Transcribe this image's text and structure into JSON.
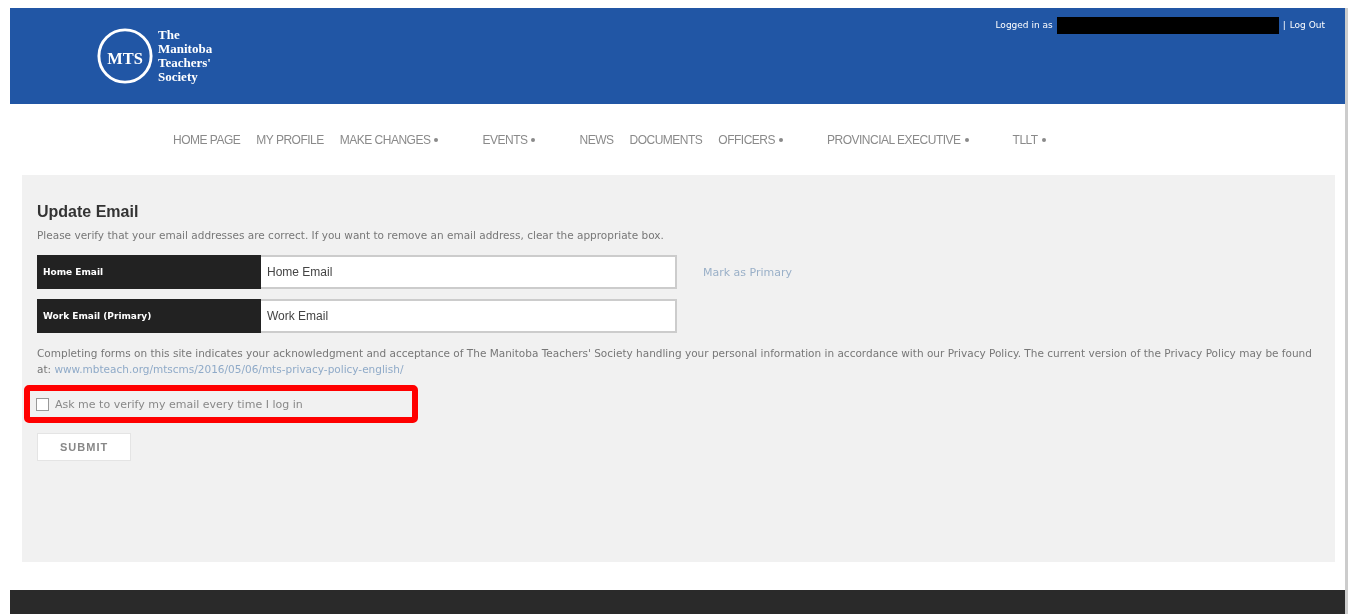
{
  "header": {
    "logo_mark": "MTS",
    "logo_text": [
      "The",
      "Manitoba",
      "Teachers'",
      "Society"
    ],
    "logged_in_label": "Logged in as",
    "separator": "|",
    "logout": "Log Out"
  },
  "nav": [
    {
      "label": "HOME PAGE",
      "has_dropdown": false
    },
    {
      "label": "MY PROFILE",
      "has_dropdown": false
    },
    {
      "label": "MAKE CHANGES",
      "has_dropdown": true
    },
    {
      "label": "EVENTS",
      "has_dropdown": true
    },
    {
      "label": "NEWS",
      "has_dropdown": false
    },
    {
      "label": "DOCUMENTS",
      "has_dropdown": false
    },
    {
      "label": "OFFICERS",
      "has_dropdown": true
    },
    {
      "label": "PROVINCIAL EXECUTIVE",
      "has_dropdown": true
    },
    {
      "label": "TLLT",
      "has_dropdown": true
    }
  ],
  "form": {
    "title": "Update Email",
    "intro": "Please verify that your email addresses are correct. If you want to remove an email address, clear the appropriate box.",
    "emails": [
      {
        "label": "Home Email",
        "value": "Home Email",
        "action": "Mark as Primary"
      },
      {
        "label": "Work Email (Primary)",
        "value": "Work Email"
      }
    ],
    "notice": "Completing forms on this site indicates your acknowledgment and acceptance of The Manitoba Teachers' Society handling your personal information in accordance with our Privacy Policy. The current version of the Privacy Policy may be found at:",
    "notice_link": "www.mbteach.org/mtscms/2016/05/06/mts-privacy-policy-english/",
    "verify_checkbox": {
      "label": "Ask me to verify my email every time I log in",
      "checked": false,
      "highlighted": true
    },
    "submit": "SUBMIT"
  }
}
